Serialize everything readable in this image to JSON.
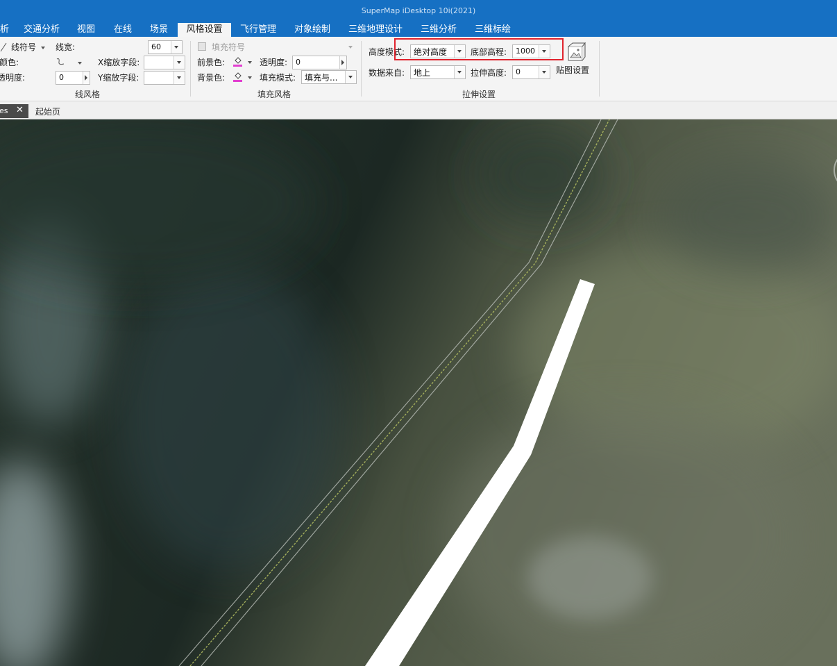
{
  "window": {
    "title": "SuperMap iDesktop 10i(2021)"
  },
  "menu": {
    "tabs": [
      {
        "label": "析",
        "active": false
      },
      {
        "label": "交通分析",
        "active": false
      },
      {
        "label": "视图",
        "active": false
      },
      {
        "label": "在线",
        "active": false
      },
      {
        "label": "场景",
        "active": false
      },
      {
        "label": "风格设置",
        "active": true
      },
      {
        "label": "飞行管理",
        "active": false
      },
      {
        "label": "对象绘制",
        "active": false
      },
      {
        "label": "三维地理设计",
        "active": false
      },
      {
        "label": "三维分析",
        "active": false
      },
      {
        "label": "三维标绘",
        "active": false
      }
    ]
  },
  "line_style": {
    "symbol_label": "线符号",
    "width_label": "线宽:",
    "width_value": "60",
    "color_label": "颜色:",
    "x_scale_label": "X缩放字段:",
    "x_scale_value": "",
    "transparency_label": "透明度:",
    "transparency_value": "0",
    "y_scale_label": "Y缩放字段:",
    "y_scale_value": "",
    "group_label": "线风格"
  },
  "fill_style": {
    "symbol_label": "填充符号",
    "fore_color_label": "前景色:",
    "transparency_label": "透明度:",
    "transparency_value": "0",
    "back_color_label": "背景色:",
    "fill_mode_label": "填充模式:",
    "fill_mode_value": "填充与...",
    "group_label": "填充风格"
  },
  "extrude": {
    "height_mode_label": "高度模式:",
    "height_mode_value": "绝对高度",
    "bottom_altitude_label": "底部高程:",
    "bottom_altitude_value": "1000",
    "data_source_label": "数据来自:",
    "data_source_value": "地上",
    "extrude_height_label": "拉伸高度:",
    "extrude_height_value": "0",
    "texture_button_label": "贴图设置",
    "group_label": "拉伸设置"
  },
  "doc_tabs": [
    {
      "label": "es",
      "active": true,
      "close": "✕"
    },
    {
      "label": "起始页",
      "active": false
    }
  ],
  "colors": {
    "title_bar": "#1670c3",
    "highlight_box": "#e0232d",
    "fore_color_swatch": "#e23fd0",
    "back_color_swatch": "#e23fd0"
  }
}
